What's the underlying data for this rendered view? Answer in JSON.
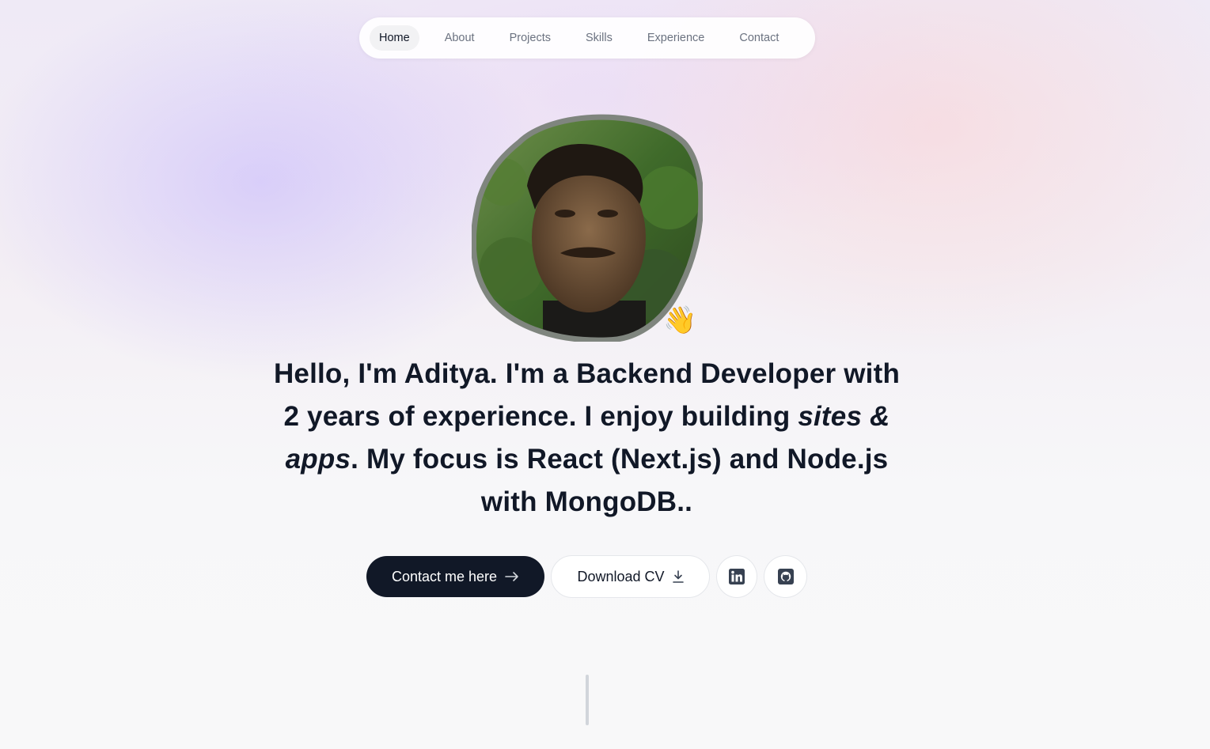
{
  "nav": {
    "items": [
      {
        "label": "Home",
        "active": true
      },
      {
        "label": "About",
        "active": false
      },
      {
        "label": "Projects",
        "active": false
      },
      {
        "label": "Skills",
        "active": false
      },
      {
        "label": "Experience",
        "active": false
      },
      {
        "label": "Contact",
        "active": false
      }
    ]
  },
  "hero": {
    "avatar_icon": "profile-photo",
    "wave_emoji": "👋",
    "headline": {
      "p1": "Hello, I'm Aditya.",
      "p2": " I'm a ",
      "p3": "Backend Developer",
      "p4": " with ",
      "p5": "2 years",
      "p6": " of experience. I enjoy building ",
      "p7": "sites & apps",
      "p8": ". My focus is ",
      "p9": "React (Next.js)",
      "p10": " and Node.js with MongoDB",
      "p11": ".."
    }
  },
  "actions": {
    "contact_label": "Contact me here",
    "contact_icon": "arrow-right-icon",
    "cv_label": "Download CV",
    "cv_icon": "download-icon",
    "linkedin_icon": "linkedin-icon",
    "github_icon": "github-icon"
  },
  "colors": {
    "primary": "#111827",
    "muted": "#6b7280",
    "accent_purple": "#c4b5fd",
    "accent_pink": "#fdcdcd"
  }
}
